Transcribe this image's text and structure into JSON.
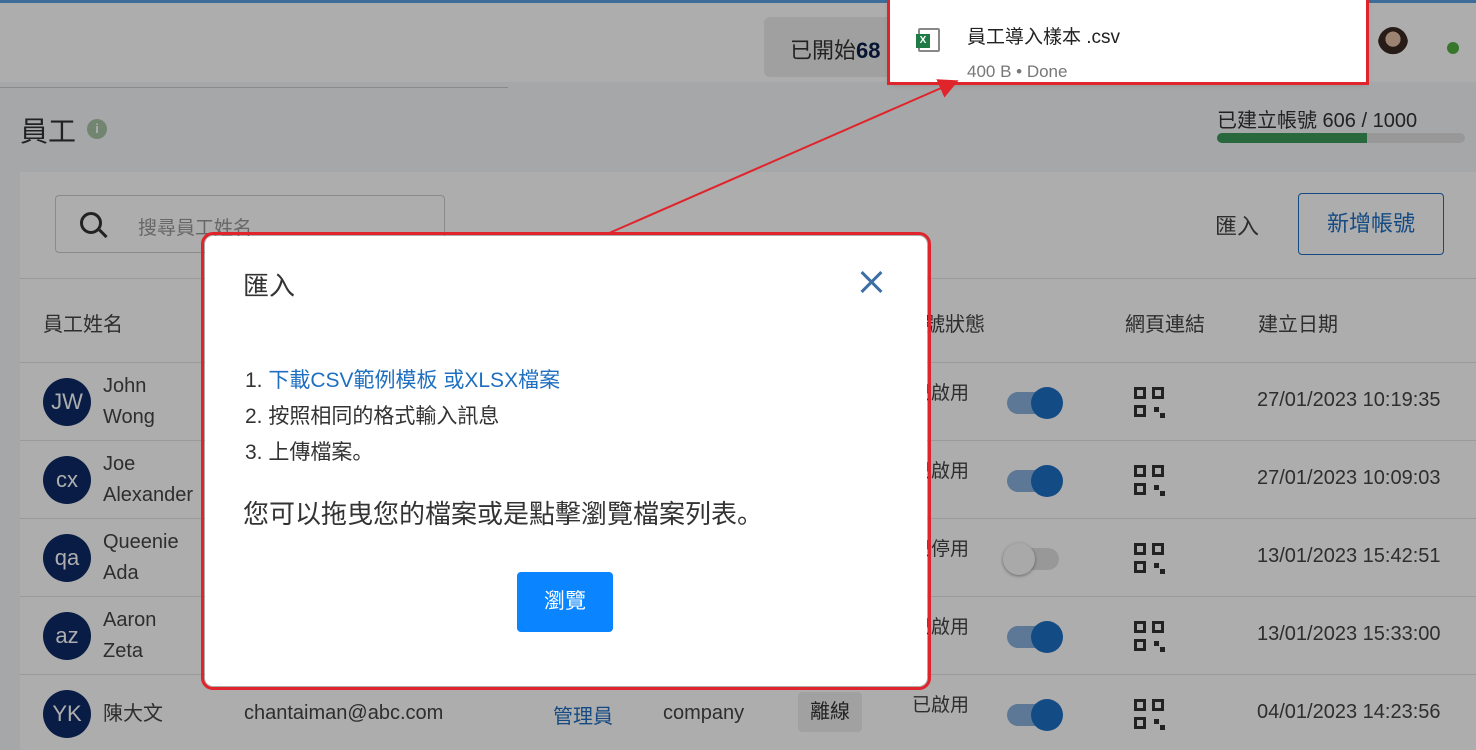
{
  "topbar": {
    "started_label": "已開始",
    "started_count": "68"
  },
  "page": {
    "title": "員工",
    "info_icon": "i",
    "quota_label": "已建立帳號 606 / 1000",
    "quota_fraction": 0.606
  },
  "toolbar": {
    "search_placeholder": "搜尋員工姓名",
    "import_label": "匯入",
    "add_label": "新增帳號"
  },
  "table": {
    "headers": {
      "name": "員工姓名",
      "account_status": "帳號狀態",
      "web_link": "網頁連結",
      "created_date": "建立日期"
    },
    "rows": [
      {
        "initials": "JW",
        "name_line1": "John",
        "name_line2": "Wong",
        "status": "已啟用",
        "enabled": true,
        "date": "27/01/2023 10:19:35"
      },
      {
        "initials": "cx",
        "name_line1": "Joe",
        "name_line2": "Alexander",
        "status": "已啟用",
        "enabled": true,
        "date": "27/01/2023 10:09:03"
      },
      {
        "initials": "qa",
        "name_line1": "Queenie",
        "name_line2": "Ada",
        "status": "已停用",
        "enabled": false,
        "date": "13/01/2023 15:42:51"
      },
      {
        "initials": "az",
        "name_line1": "Aaron",
        "name_line2": "Zeta",
        "status": "已啟用",
        "enabled": true,
        "date": "13/01/2023 15:33:00"
      },
      {
        "initials": "YK",
        "name_line1": "陳大文",
        "name_line2": "",
        "email": "chantaiman@abc.com",
        "role": "管理員",
        "company": "company",
        "presence": "離線",
        "status": "已啟用",
        "enabled": true,
        "date": "04/01/2023 14:23:56"
      }
    ]
  },
  "modal": {
    "title": "匯入",
    "step1_prefix": "1. ",
    "step1_link": "下載CSV範例模板  或XLSX檔案",
    "step2": "2. 按照相同的格式輸入訊息",
    "step3": "3. 上傳檔案。",
    "description": "您可以拖曳您的檔案或是點擊瀏覽檔案列表。",
    "browse_label": "瀏覽"
  },
  "download": {
    "file_name": "員工導入樣本 .csv",
    "file_status": "400 B • Done"
  },
  "colors": {
    "accent": "#1f6fc0",
    "highlight": "#e0242b",
    "avatar": "#0c2a66",
    "browse": "#0a84ff"
  }
}
